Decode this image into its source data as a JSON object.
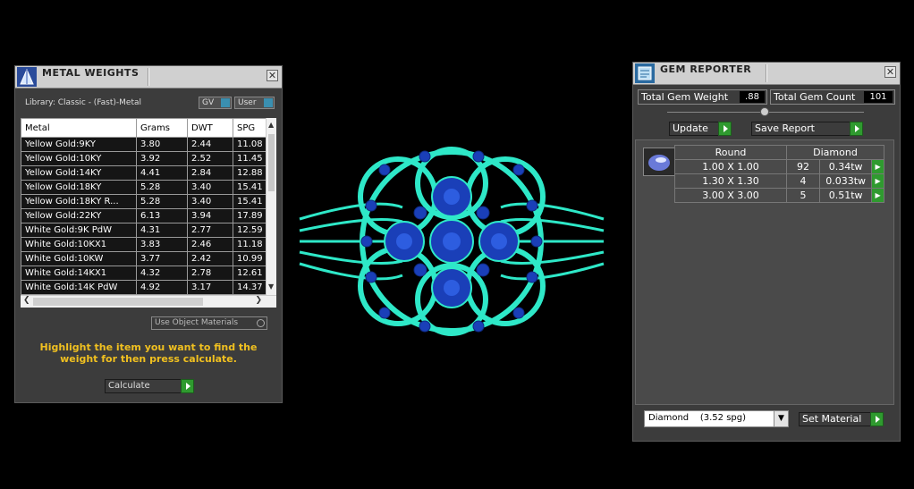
{
  "metal_weights": {
    "title": "METAL WEIGHTS",
    "library_label": "Library: Classic - (Fast)-Metal",
    "gv_label": "GV",
    "user_label": "User",
    "columns": [
      "Metal",
      "Grams",
      "DWT",
      "SPG"
    ],
    "rows": [
      {
        "metal": "Yellow Gold:9KY",
        "grams": "3.80",
        "dwt": "2.44",
        "spg": "11.08"
      },
      {
        "metal": "Yellow Gold:10KY",
        "grams": "3.92",
        "dwt": "2.52",
        "spg": "11.45"
      },
      {
        "metal": "Yellow Gold:14KY",
        "grams": "4.41",
        "dwt": "2.84",
        "spg": "12.88"
      },
      {
        "metal": "Yellow Gold:18KY",
        "grams": "5.28",
        "dwt": "3.40",
        "spg": "15.41"
      },
      {
        "metal": "Yellow Gold:18KY R...",
        "grams": "5.28",
        "dwt": "3.40",
        "spg": "15.41"
      },
      {
        "metal": "Yellow Gold:22KY",
        "grams": "6.13",
        "dwt": "3.94",
        "spg": "17.89"
      },
      {
        "metal": "White Gold:9K PdW",
        "grams": "4.31",
        "dwt": "2.77",
        "spg": "12.59"
      },
      {
        "metal": "White Gold:10KX1",
        "grams": "3.83",
        "dwt": "2.46",
        "spg": "11.18"
      },
      {
        "metal": "White Gold:10KW",
        "grams": "3.77",
        "dwt": "2.42",
        "spg": "10.99"
      },
      {
        "metal": "White Gold:14KX1",
        "grams": "4.32",
        "dwt": "2.78",
        "spg": "12.61"
      },
      {
        "metal": "White Gold:14K PdW",
        "grams": "4.92",
        "dwt": "3.17",
        "spg": "14.37"
      }
    ],
    "use_object_materials_label": "Use Object Materials",
    "instruction": "Highlight the item you want to find the weight for then press calculate.",
    "calculate_label": "Calculate"
  },
  "gem_reporter": {
    "title": "GEM REPORTER",
    "total_weight_label": "Total Gem Weight",
    "total_weight_value": ".88",
    "total_count_label": "Total Gem Count",
    "total_count_value": "101",
    "update_label": "Update",
    "save_report_label": "Save Report",
    "table_header": {
      "shape": "Round",
      "material": "Diamond"
    },
    "rows": [
      {
        "size": "1.00 X 1.00",
        "count": "92",
        "tw": "0.34tw"
      },
      {
        "size": "1.30 X 1.30",
        "count": "4",
        "tw": "0.033tw"
      },
      {
        "size": "3.00 X 3.00",
        "count": "5",
        "tw": "0.51tw"
      }
    ],
    "material_select": "Diamond    (3.52 spg)",
    "set_material_label": "Set Material"
  },
  "colors": {
    "instruction_text": "#f0c020",
    "ring_metal": "#2ee8c8",
    "gem_blue": "#1a3fb8"
  }
}
